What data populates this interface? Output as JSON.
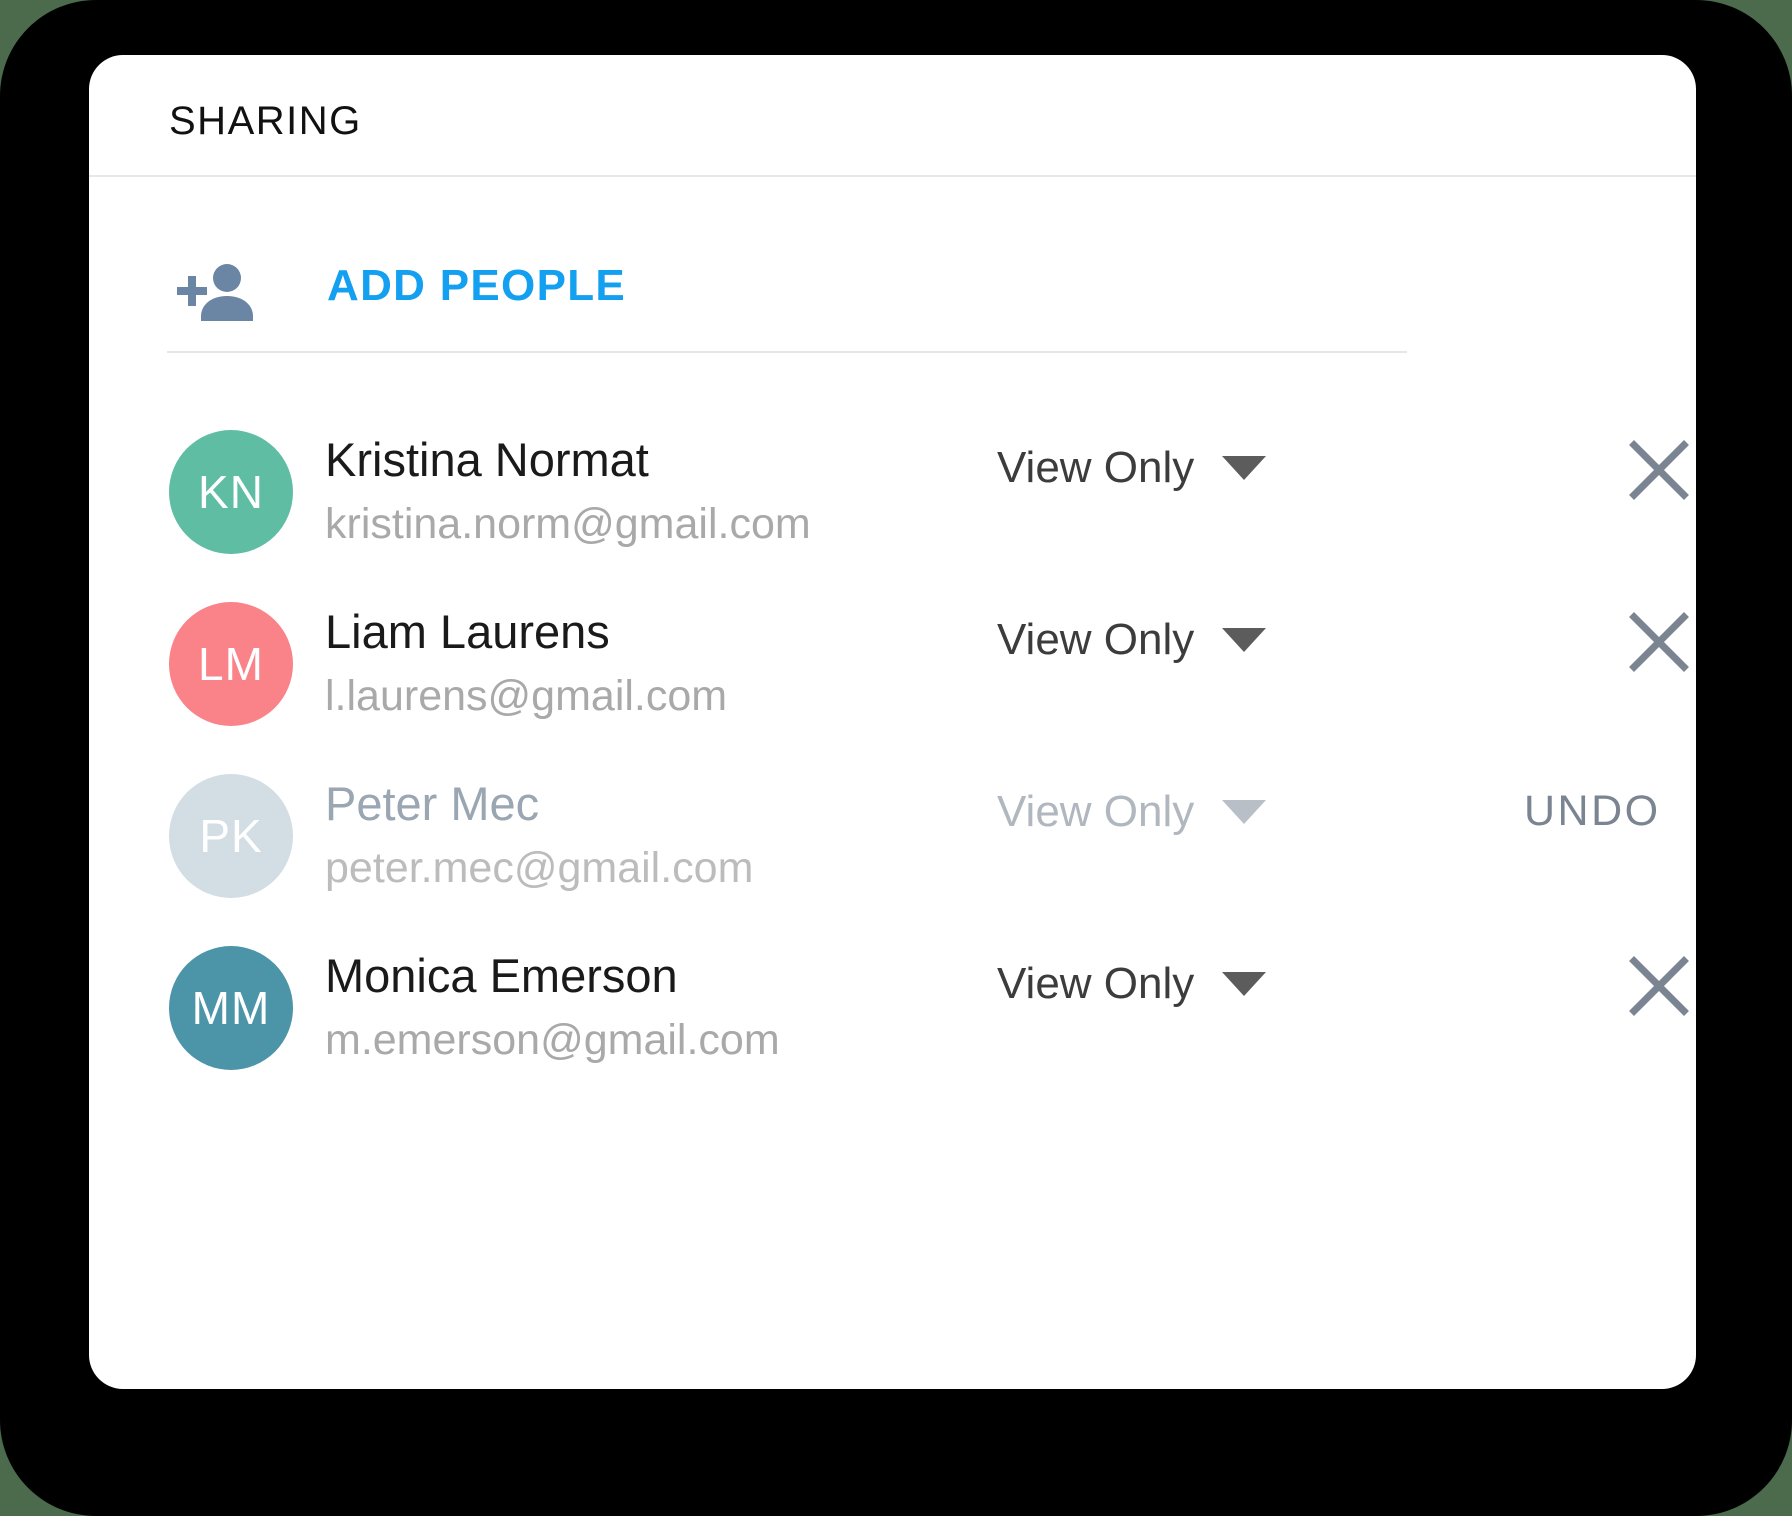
{
  "header": {
    "title": "SHARING"
  },
  "add_people": {
    "label": "ADD PEOPLE",
    "icon": "person-add-icon",
    "icon_color": "#6b85a5",
    "label_color": "#14a0f0"
  },
  "people": [
    {
      "initials": "KN",
      "avatar_color": "#5fbda4",
      "name": "Kristina Normat",
      "email": "kristina.norm@gmail.com",
      "permission": "View Only",
      "action_label": "",
      "action_type": "remove-x",
      "state": "active"
    },
    {
      "initials": "LM",
      "avatar_color": "#fa8289",
      "name": "Liam Laurens",
      "email": "l.laurens@gmail.com",
      "permission": "View Only",
      "action_label": "",
      "action_type": "remove-x",
      "state": "active"
    },
    {
      "initials": "PK",
      "avatar_color": "#d2dee4",
      "name": "Peter Mec",
      "email": "peter.mec@gmail.com",
      "permission": "View Only",
      "action_label": "UNDO",
      "action_type": "undo",
      "state": "disabled"
    },
    {
      "initials": "MM",
      "avatar_color": "#4c95a9",
      "name": "Monica Emerson",
      "email": "m.emerson@gmail.com",
      "permission": "View Only",
      "action_label": "",
      "action_type": "remove-x",
      "state": "active"
    }
  ],
  "colors": {
    "background": "#4b6b4c",
    "bezel": "#000000",
    "card": "#ffffff",
    "accent_blue": "#14a0f0",
    "remove_icon": "#7b8592",
    "divider": "#e6e6e6"
  }
}
